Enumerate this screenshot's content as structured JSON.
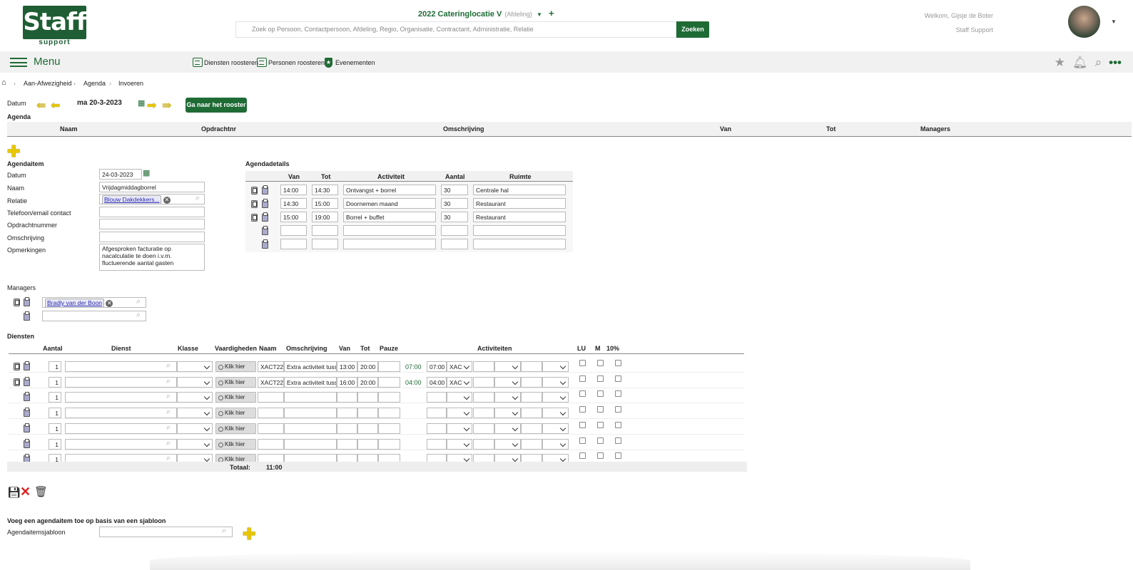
{
  "header": {
    "logo_text": "Staff",
    "logo_sub": "support",
    "organisation": "2022 Cateringlocatie V",
    "organisation_type": "(Afdeling)",
    "search_placeholder": "Zoek op Persoon, Contactpersoon, Afdeling, Regio, Organisatie, Contractant, Administratie, Relatie",
    "search_button": "Zoeken",
    "welcome": "Welkom, Gijsje de Boter",
    "role": "Staff Support"
  },
  "navbar": {
    "menu_label": "Menu",
    "links": [
      "Diensten roosteren",
      "Personen roosteren",
      "Evenementen"
    ]
  },
  "breadcrumb": [
    "Aan-Afwezigheid",
    "Agenda",
    "Invoeren"
  ],
  "date_nav": {
    "label": "Datum",
    "current_date": "ma 20-3-2023",
    "goto_button": "Ga naar het rooster"
  },
  "agenda": {
    "title": "Agenda",
    "columns": [
      "Naam",
      "Opdrachtnr",
      "Omschrijving",
      "Van",
      "Tot",
      "Managers"
    ]
  },
  "agendaitem": {
    "title": "Agendaitem",
    "fields": {
      "datum_label": "Datum",
      "datum_value": "24-03-2023",
      "naam_label": "Naam",
      "naam_value": "Vrijdagmiddagborrel",
      "relatie_label": "Relatie",
      "relatie_value": "Blouw Dakdekkers...",
      "telefoon_label": "Telefoon/email contact",
      "opdrachtnummer_label": "Opdrachtnummer",
      "omschrijving_label": "Omschrijving",
      "opmerkingen_label": "Opmerkingen",
      "opmerkingen_value": "Afgesproken facturatie op nacalculatie te doen i.v.m. fluctuerende aantal gasten"
    }
  },
  "agendadetails": {
    "title": "Agendadetails",
    "columns": [
      "Van",
      "Tot",
      "Activiteit",
      "Aantal",
      "Ruimte"
    ],
    "rows": [
      {
        "van": "14:00",
        "tot": "14:30",
        "activiteit": "Ontvangst + borrel",
        "aantal": "30",
        "ruimte": "Centrale hal"
      },
      {
        "van": "14:30",
        "tot": "15:00",
        "activiteit": "Doornemen maand",
        "aantal": "30",
        "ruimte": "Restaurant"
      },
      {
        "van": "15:00",
        "tot": "19:00",
        "activiteit": "Borrel + buffet",
        "aantal": "30",
        "ruimte": "Restaurant"
      },
      {
        "van": "",
        "tot": "",
        "activiteit": "",
        "aantal": "",
        "ruimte": ""
      },
      {
        "van": "",
        "tot": "",
        "activiteit": "",
        "aantal": "",
        "ruimte": ""
      }
    ]
  },
  "managers": {
    "title": "Managers",
    "items": [
      "Bradly van der Boon",
      ""
    ]
  },
  "diensten": {
    "title": "Diensten",
    "columns": [
      "Aantal",
      "Dienst",
      "Klasse",
      "Vaardigheden",
      "Naam",
      "Omschrijving",
      "Van",
      "Tot",
      "Pauze",
      "Activiteiten",
      "LU",
      "M",
      "10%"
    ],
    "klik_label": "Klik hier",
    "rows": [
      {
        "aantal": "1",
        "naam": "XACT22",
        "omschrijving": "Extra activiteit tuss",
        "van": "13:00",
        "tot": "20:00",
        "duur": "07:00",
        "act_tijd": "07:00",
        "act_code": "XAC"
      },
      {
        "aantal": "1",
        "naam": "XACT22",
        "omschrijving": "Extra activiteit tuss",
        "van": "16:00",
        "tot": "20:00",
        "duur": "04:00",
        "act_tijd": "04:00",
        "act_code": "XAC"
      },
      {
        "aantal": "1",
        "naam": "",
        "omschrijving": "",
        "van": "",
        "tot": "",
        "duur": "",
        "act_tijd": "",
        "act_code": ""
      },
      {
        "aantal": "1",
        "naam": "",
        "omschrijving": "",
        "van": "",
        "tot": "",
        "duur": "",
        "act_tijd": "",
        "act_code": ""
      },
      {
        "aantal": "1",
        "naam": "",
        "omschrijving": "",
        "van": "",
        "tot": "",
        "duur": "",
        "act_tijd": "",
        "act_code": ""
      },
      {
        "aantal": "1",
        "naam": "",
        "omschrijving": "",
        "van": "",
        "tot": "",
        "duur": "",
        "act_tijd": "",
        "act_code": ""
      },
      {
        "aantal": "1",
        "naam": "",
        "omschrijving": "",
        "van": "",
        "tot": "",
        "duur": "",
        "act_tijd": "",
        "act_code": ""
      }
    ],
    "totaal_label": "Totaal:",
    "totaal_value": "11:00"
  },
  "sjabloon": {
    "title": "Voeg een agendaitem toe op basis van een sjabloon",
    "field_label": "Agendaitemsjabloon"
  }
}
